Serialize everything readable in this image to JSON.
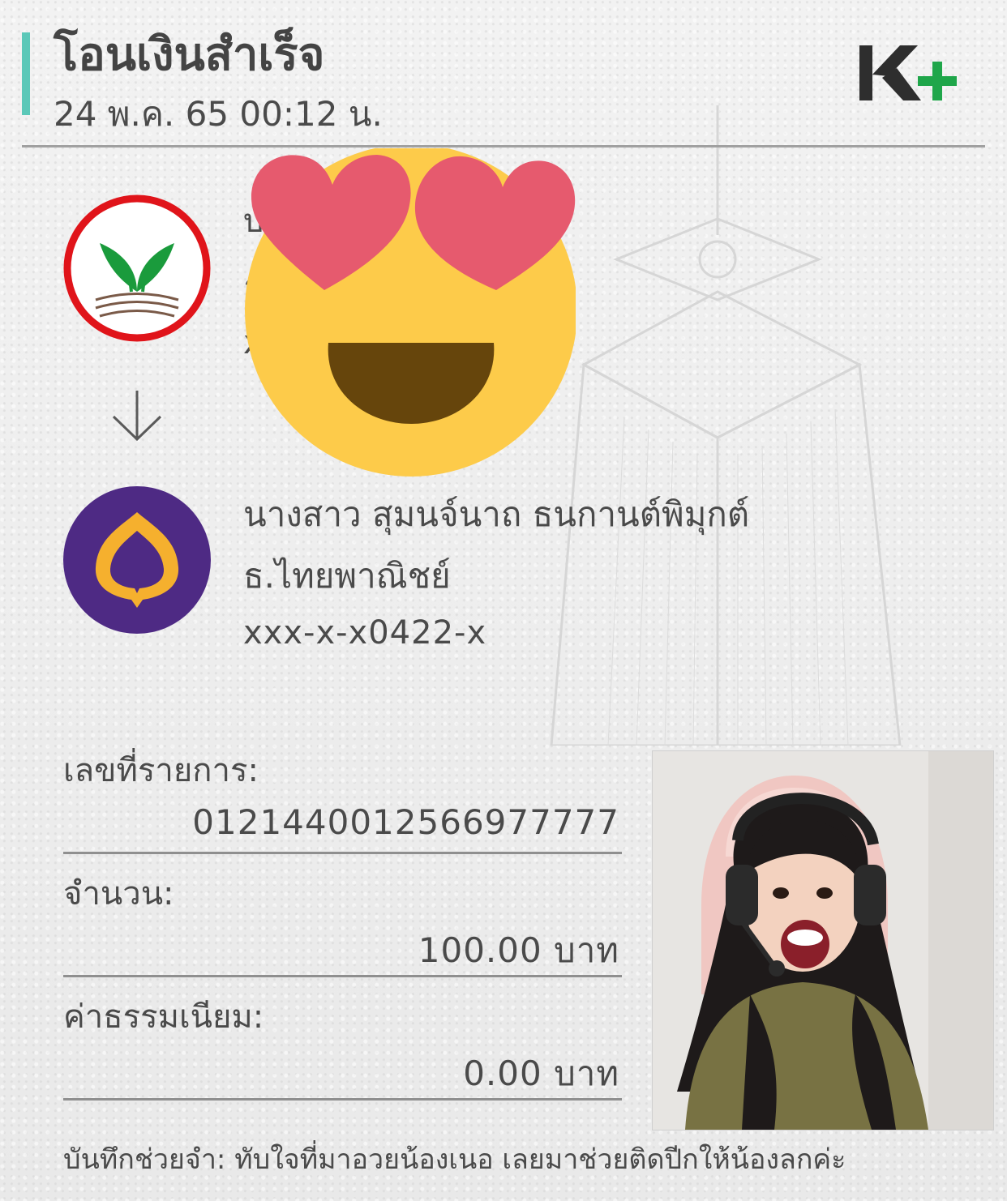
{
  "header": {
    "title": "โอนเงินสำเร็จ",
    "datetime": "24 พ.ค. 65  00:12 น.",
    "brand": "K+",
    "brand_colors": {
      "k": "#2e2e2e",
      "plus": "#1fa64a",
      "accent": "#5bc8b8"
    }
  },
  "sender": {
    "bank_icon": "kasikorn-bank-icon",
    "lines": [
      "บ",
      "ธ",
      "x"
    ]
  },
  "arrow_icon": "arrow-down-icon",
  "sticker": "heart-eyes-emoji",
  "receiver": {
    "bank_icon": "scb-bank-icon",
    "name": "นางสาว สุมนจ์นาถ ธนกานต์พิมุกต์",
    "bank": "ธ.ไทยพาณิชย์",
    "account": "xxx-x-x0422-x"
  },
  "details": {
    "ref_label": "เลขที่รายการ:",
    "ref_value": "0121440012566977777",
    "amount_label": "จำนวน:",
    "amount_value": "100.00 บาท",
    "fee_label": "ค่าธรรมเนียม:",
    "fee_value": "0.00 บาท"
  },
  "memo": {
    "label": "บันทึกช่วยจำ:",
    "text": "ทับใจที่มาอวยน้องเนอ เลยมาช่วยติดปีกให้น้องลกค่ะ"
  }
}
